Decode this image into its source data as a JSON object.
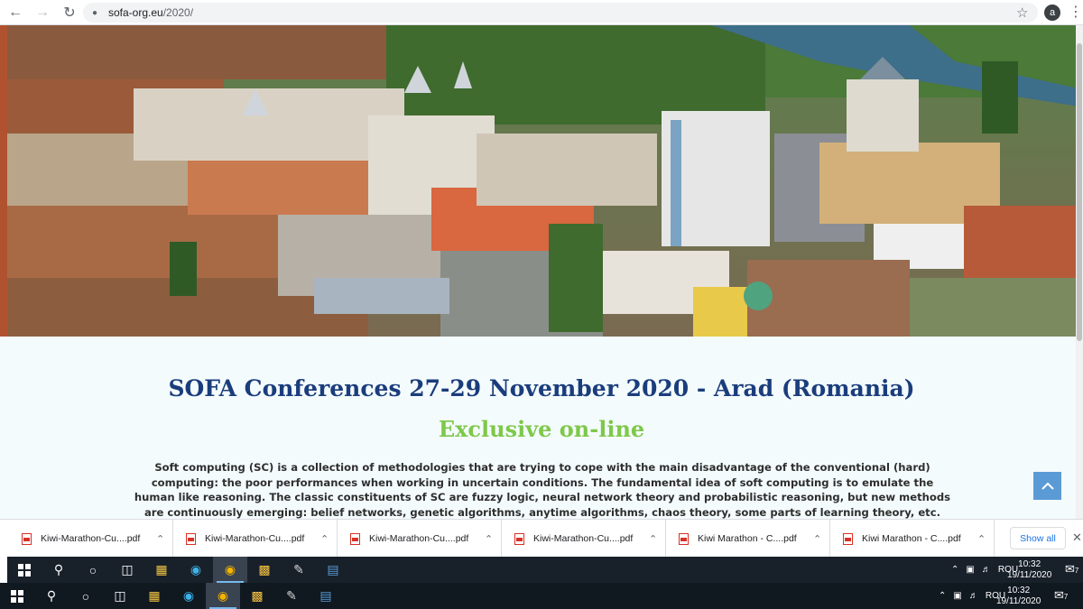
{
  "browser": {
    "url_host": "sofa-org.eu",
    "url_path": "/2020/",
    "profile_initial": "a"
  },
  "page": {
    "title": "SOFA Conferences 27-29 November 2020 - Arad (Romania)",
    "subtitle": "Exclusive on-line",
    "intro": "Soft computing (SC) is a collection of methodologies that are trying to cope with the main disadvantage of the conventional (hard) computing: the poor performances when working in uncertain conditions. The fundamental idea of soft computing is to emulate the human like reasoning. The classic constituents of SC are fuzzy logic, neural network theory and probabilistic reasoning, but new methods are continuously emerging: belief networks, genetic algorithms, anytime algorithms, chaos theory, some parts of learning theory, etc."
  },
  "downloads": {
    "items": [
      {
        "name": "Kiwi-Marathon-Cu....pdf"
      },
      {
        "name": "Kiwi-Marathon-Cu....pdf"
      },
      {
        "name": "Kiwi-Marathon-Cu....pdf"
      },
      {
        "name": "Kiwi-Marathon-Cu....pdf"
      },
      {
        "name": "Kiwi Marathon - C....pdf"
      },
      {
        "name": "Kiwi Marathon - C....pdf"
      }
    ],
    "show_all": "Show all"
  },
  "taskbar": {
    "lang": "ROU",
    "time": "10:32",
    "date": "19/11/2020",
    "notifications": "7"
  }
}
